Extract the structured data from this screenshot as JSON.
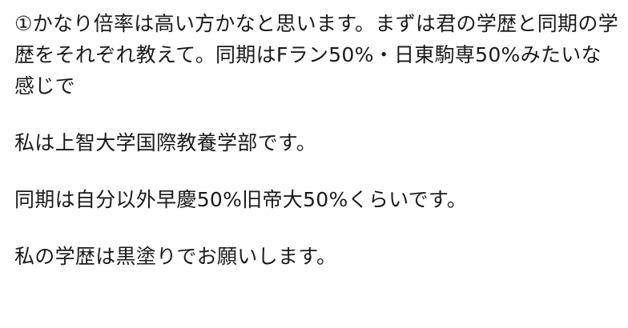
{
  "post": {
    "paragraphs": [
      "①かなり倍率は高い方かなと思います。まずは君の学歴と同期の学歴をそれぞれ教えて。同期はFラン50%・日東駒専50%みたいな感じで",
      "私は上智大学国際教養学部です。",
      "同期は自分以外早慶50%旧帝大50%くらいです。",
      "私の学歴は黒塗りでお願いします。"
    ]
  },
  "colors": {
    "text": "#1a1a1a",
    "background": "#ffffff"
  }
}
